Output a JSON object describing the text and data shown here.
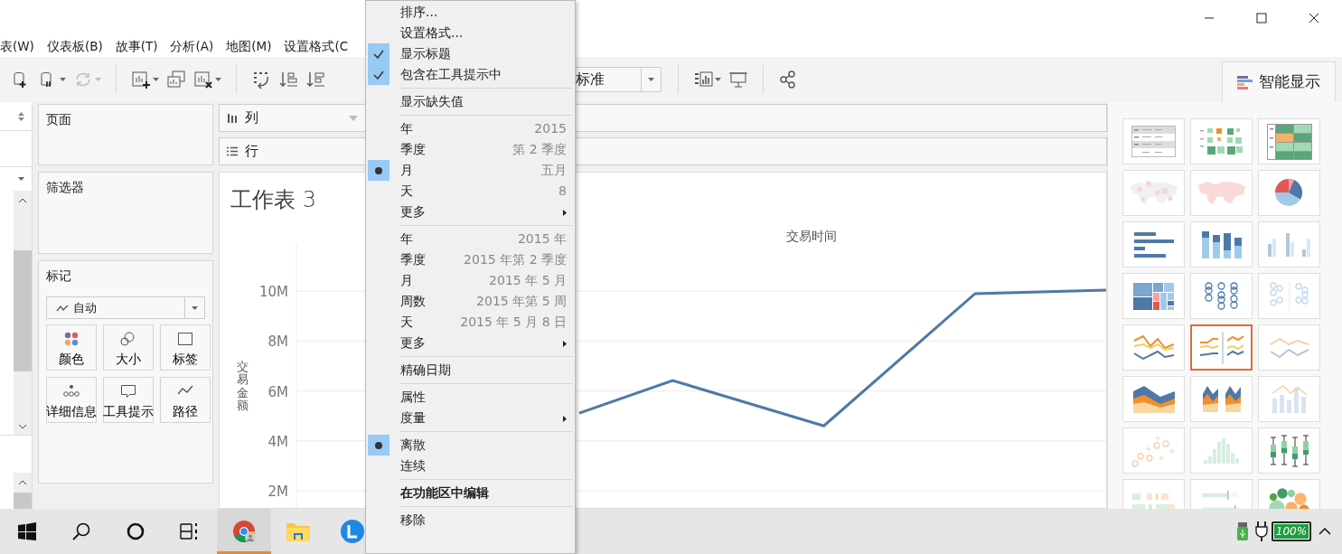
{
  "menu_bar": [
    "表(W)",
    "仪表板(B)",
    "故事(T)",
    "分析(A)",
    "地图(M)",
    "设置格式(C"
  ],
  "toolbar": [
    {
      "kind": "datasource",
      "disabled": false,
      "dropdown": false
    },
    {
      "kind": "pause",
      "disabled": false,
      "dropdown": true
    },
    {
      "kind": "refresh",
      "disabled": true,
      "dropdown": true
    },
    {
      "kind": "separator"
    },
    {
      "kind": "newsheet",
      "disabled": false,
      "dropdown": true
    },
    {
      "kind": "duplicate",
      "disabled": false,
      "dropdown": false
    },
    {
      "kind": "clear",
      "disabled": false,
      "dropdown": true
    },
    {
      "kind": "separator"
    },
    {
      "kind": "swap",
      "disabled": false,
      "dropdown": false
    },
    {
      "kind": "sortasc",
      "disabled": false,
      "dropdown": false
    },
    {
      "kind": "sortdesc",
      "disabled": false,
      "dropdown": false
    },
    {
      "kind": "fit",
      "value": "标准"
    },
    {
      "kind": "separator"
    },
    {
      "kind": "cards",
      "disabled": false,
      "dropdown": true
    },
    {
      "kind": "present",
      "disabled": false,
      "dropdown": false
    },
    {
      "kind": "separator"
    },
    {
      "kind": "share",
      "disabled": false,
      "dropdown": false
    }
  ],
  "show_me_tab": "智能显示",
  "pages_card": {
    "title": "页面"
  },
  "filters_card": {
    "title": "筛选器"
  },
  "marks_card": {
    "title": "标记",
    "mark_type": "自动",
    "buttons": [
      {
        "kind": "color",
        "label": "颜色"
      },
      {
        "kind": "size",
        "label": "大小"
      },
      {
        "kind": "label",
        "label": "标签"
      },
      {
        "kind": "detail",
        "label": "详细信息"
      },
      {
        "kind": "tooltip",
        "label": "工具提示"
      },
      {
        "kind": "path",
        "label": "路径"
      }
    ]
  },
  "columns_shelf": {
    "label": "列"
  },
  "rows_shelf": {
    "label": "行"
  },
  "sheet": {
    "title": "工作表 3",
    "x_axis_title": "交易时间",
    "y_axis_title": "交易金额",
    "y_ticks": [
      "10M",
      "8M",
      "6M",
      "4M",
      "2M"
    ]
  },
  "show_me": [
    {
      "kind": "table",
      "selected": false,
      "disabled": false
    },
    {
      "kind": "heatmap",
      "selected": false,
      "disabled": false
    },
    {
      "kind": "highlight",
      "selected": false,
      "disabled": false
    },
    {
      "kind": "symbolmap",
      "selected": false,
      "disabled": true
    },
    {
      "kind": "filledmap",
      "selected": false,
      "disabled": true
    },
    {
      "kind": "pie",
      "selected": false,
      "disabled": false
    },
    {
      "kind": "hbar",
      "selected": false,
      "disabled": false
    },
    {
      "kind": "stackedbar",
      "selected": false,
      "disabled": false
    },
    {
      "kind": "sidebars",
      "selected": false,
      "disabled": true
    },
    {
      "kind": "treemap",
      "selected": false,
      "disabled": false
    },
    {
      "kind": "circles",
      "selected": false,
      "disabled": false
    },
    {
      "kind": "sidecircles",
      "selected": false,
      "disabled": true
    },
    {
      "kind": "lines",
      "selected": false,
      "disabled": false
    },
    {
      "kind": "linesdiscrete",
      "selected": true,
      "disabled": false
    },
    {
      "kind": "duallines",
      "selected": false,
      "disabled": true
    },
    {
      "kind": "area",
      "selected": false,
      "disabled": false
    },
    {
      "kind": "areadiscrete",
      "selected": false,
      "disabled": false
    },
    {
      "kind": "combo",
      "selected": false,
      "disabled": true
    },
    {
      "kind": "scatter",
      "selected": false,
      "disabled": true
    },
    {
      "kind": "histogram",
      "selected": false,
      "disabled": true
    },
    {
      "kind": "boxplot",
      "selected": false,
      "disabled": false
    },
    {
      "kind": "gantt",
      "selected": false,
      "disabled": true
    },
    {
      "kind": "bullet",
      "selected": false,
      "disabled": true
    },
    {
      "kind": "bubbles",
      "selected": false,
      "disabled": false
    }
  ],
  "context_menu": [
    {
      "kind": "item",
      "label": "排序..."
    },
    {
      "kind": "item",
      "label": "设置格式..."
    },
    {
      "kind": "check",
      "label": "显示标题",
      "checked": true
    },
    {
      "kind": "check",
      "label": "包含在工具提示中",
      "checked": true
    },
    {
      "kind": "separator"
    },
    {
      "kind": "check",
      "label": "显示缺失值",
      "checked": false
    },
    {
      "kind": "separator"
    },
    {
      "kind": "radio",
      "label": "年",
      "value": "2015",
      "selected": false
    },
    {
      "kind": "radio",
      "label": "季度",
      "value": "第 2 季度",
      "selected": false
    },
    {
      "kind": "radio",
      "label": "月",
      "value": "五月",
      "selected": true
    },
    {
      "kind": "radio",
      "label": "天",
      "value": "8",
      "selected": false
    },
    {
      "kind": "submenu",
      "label": "更多"
    },
    {
      "kind": "separator"
    },
    {
      "kind": "radio",
      "label": "年",
      "value": "2015 年",
      "selected": false
    },
    {
      "kind": "radio",
      "label": "季度",
      "value": "2015 年第 2 季度",
      "selected": false
    },
    {
      "kind": "radio",
      "label": "月",
      "value": "2015 年 5 月",
      "selected": false
    },
    {
      "kind": "radio",
      "label": "周数",
      "value": "2015 年第 5 周",
      "selected": false
    },
    {
      "kind": "radio",
      "label": "天",
      "value": "2015 年 5 月 8 日",
      "selected": false
    },
    {
      "kind": "submenu",
      "label": "更多"
    },
    {
      "kind": "separator"
    },
    {
      "kind": "radio",
      "label": "精确日期",
      "selected": false
    },
    {
      "kind": "separator"
    },
    {
      "kind": "radio",
      "label": "属性",
      "selected": false
    },
    {
      "kind": "submenu",
      "label": "度量"
    },
    {
      "kind": "separator"
    },
    {
      "kind": "radio",
      "label": "离散",
      "selected": true
    },
    {
      "kind": "radio",
      "label": "连续",
      "selected": false
    },
    {
      "kind": "separator"
    },
    {
      "kind": "default",
      "label": "在功能区中编辑"
    },
    {
      "kind": "separator"
    },
    {
      "kind": "item",
      "label": "移除"
    }
  ],
  "taskbar": {
    "apps": [
      {
        "kind": "chrome",
        "selected": true
      },
      {
        "kind": "explorer",
        "selected": false
      },
      {
        "kind": "app",
        "selected": false
      }
    ],
    "battery": {
      "text": "100%",
      "level": 1
    }
  }
}
